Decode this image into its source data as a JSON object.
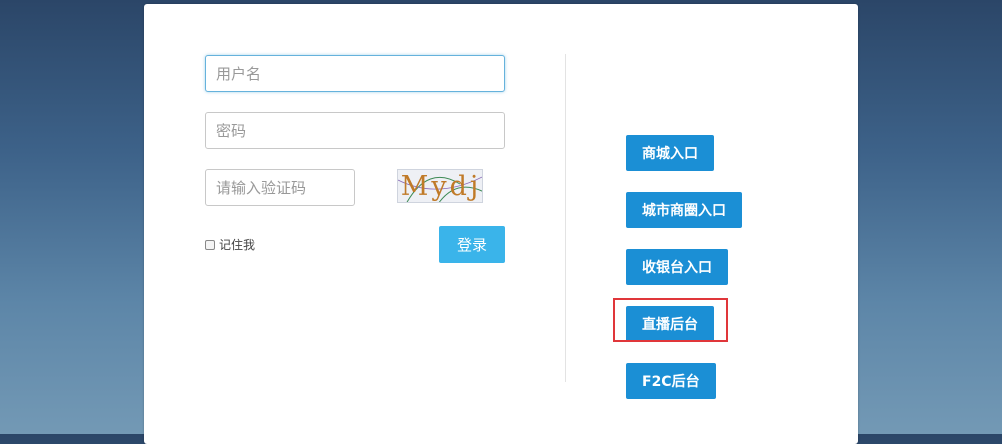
{
  "login": {
    "username_placeholder": "用户名",
    "password_placeholder": "密码",
    "captcha_placeholder": "请输入验证码",
    "captcha_code": "Mydj",
    "remember_label": "记住我",
    "login_button": "登录"
  },
  "entries": {
    "mall": "商城入口",
    "city_circle": "城市商圈入口",
    "cashier": "收银台入口",
    "live_backend": "直播后台",
    "f2c_backend": "F2C后台"
  },
  "colors": {
    "primary_button": "#1b8fd5",
    "login_button": "#3ab4ea",
    "highlight": "#e0363a"
  }
}
